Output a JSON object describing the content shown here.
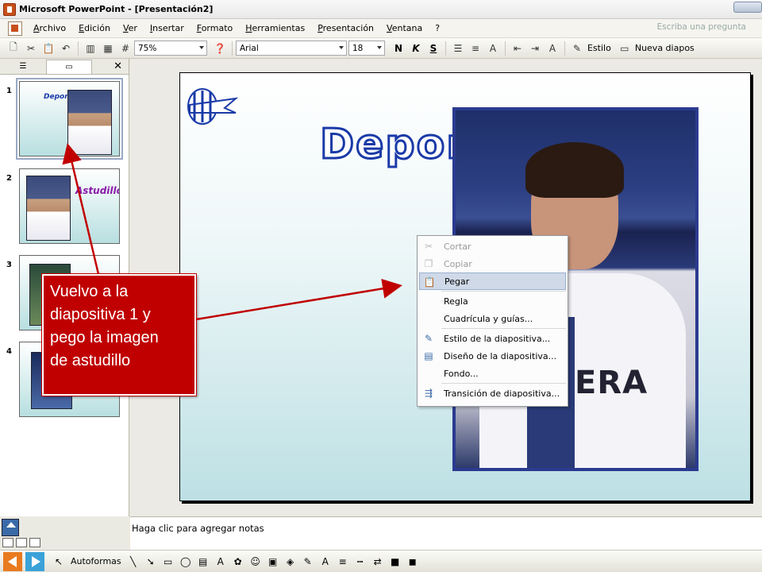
{
  "window": {
    "title": "Microsoft PowerPoint - [Presentación2]"
  },
  "menu": {
    "items": [
      "Archivo",
      "Edición",
      "Ver",
      "Insertar",
      "Formato",
      "Herramientas",
      "Presentación",
      "Ventana",
      "?"
    ],
    "help_placeholder": "Escriba una pregunta"
  },
  "toolbar": {
    "zoom": "75%",
    "font": "Arial",
    "font_size": "18",
    "bold": "N",
    "italic": "K",
    "shadow": "S",
    "style_label": "Estilo",
    "new_slide_label": "Nueva diapos"
  },
  "slides": [
    {
      "number": "1",
      "thumb_title": "Deport"
    },
    {
      "number": "2",
      "thumb_title": "Astudillo"
    },
    {
      "number": "3",
      "thumb_title": ""
    },
    {
      "number": "4",
      "thumb_title": ""
    }
  ],
  "slide": {
    "title": "Deportiv",
    "photo_text": "ERA"
  },
  "context_menu": {
    "items": [
      {
        "label": "Cortar",
        "enabled": false,
        "icon": "scissors-icon"
      },
      {
        "label": "Copiar",
        "enabled": false,
        "icon": "copy-icon"
      },
      {
        "label": "Pegar",
        "enabled": true,
        "icon": "paste-icon",
        "highlighted": true
      },
      {
        "label": "Regla",
        "enabled": true,
        "icon": ""
      },
      {
        "label": "Cuadrícula y guías...",
        "enabled": true,
        "icon": ""
      },
      {
        "label": "Estilo de la diapositiva...",
        "enabled": true,
        "icon": "slide-style-icon"
      },
      {
        "label": "Diseño de la diapositiva...",
        "enabled": true,
        "icon": "slide-layout-icon"
      },
      {
        "label": "Fondo...",
        "enabled": true,
        "icon": ""
      },
      {
        "label": "Transición de diapositiva...",
        "enabled": true,
        "icon": "transition-icon"
      }
    ]
  },
  "callout": {
    "lines": [
      "Vuelvo a la",
      "diapositiva 1 y",
      "pego la imagen",
      "de astudillo"
    ],
    "color": "#c00000"
  },
  "notes": {
    "placeholder": "Haga clic para agregar notas"
  },
  "drawing": {
    "autoshapes_label": "Autoformas"
  }
}
